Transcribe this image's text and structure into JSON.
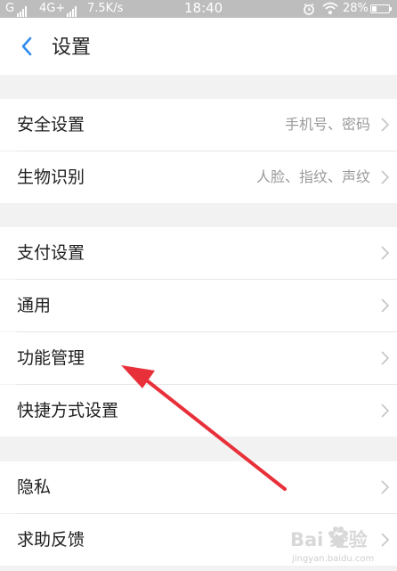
{
  "status_bar": {
    "carrier1": "G",
    "carrier2": "4G+",
    "net_speed": "7.5K/s",
    "time": "18:40",
    "battery": "28%",
    "battery_level": 0.28,
    "icons": [
      "signal-icon",
      "alarm-icon",
      "wifi-icon",
      "battery-icon"
    ]
  },
  "app_bar": {
    "back_icon": "chevron-left-icon",
    "title": "设置"
  },
  "settings": {
    "group1": [
      {
        "label": "安全设置",
        "value": "手机号、密码"
      },
      {
        "label": "生物识别",
        "value": "人脸、指纹、声纹"
      }
    ],
    "group2": [
      {
        "label": "支付设置"
      },
      {
        "label": "通用"
      },
      {
        "label": "功能管理"
      },
      {
        "label": "快捷方式设置"
      }
    ],
    "group3": [
      {
        "label": "隐私"
      },
      {
        "label": "求助反馈"
      }
    ]
  },
  "annotation": {
    "type": "arrow",
    "color": "#e8303a",
    "points_to": "功能管理"
  },
  "watermark": {
    "brand": "Bai 经验",
    "url": "jingyan.baidu.com"
  },
  "colors": {
    "accent": "#2f8cf0",
    "background": "#f2f2f2",
    "status_bar": "#bdbdbd",
    "text": "#1e1e1e",
    "secondary_text": "#9a9a9a"
  }
}
